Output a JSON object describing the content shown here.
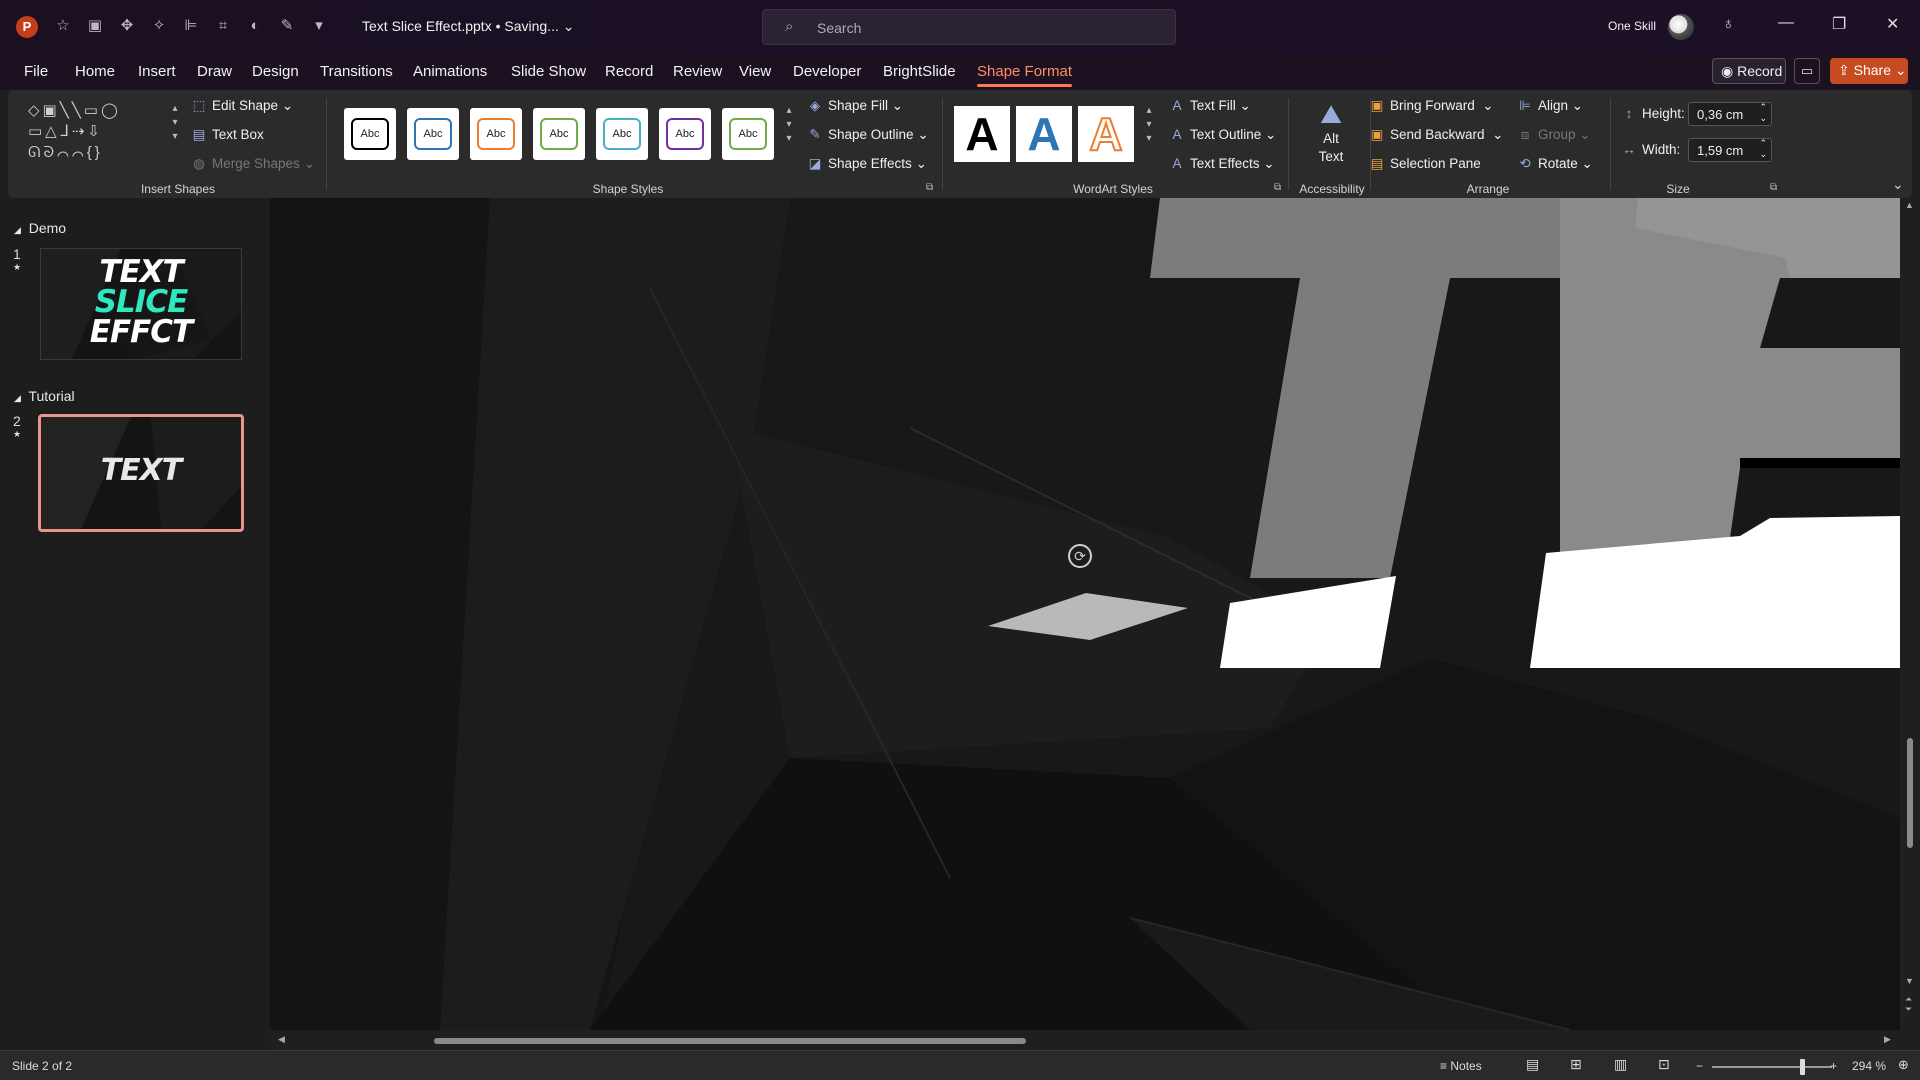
{
  "titlebar": {
    "app_logo": "P",
    "file_title": "Text Slice Effect.pptx • Saving...",
    "search_placeholder": "Search",
    "user_name": "One Skill",
    "qat_icons": [
      "autosave-icon",
      "image-icon",
      "move-icon",
      "shape-icon",
      "align-icon",
      "crop-icon",
      "fill-icon",
      "pen-icon",
      "customize-icon"
    ]
  },
  "tabs": [
    "File",
    "Home",
    "Insert",
    "Draw",
    "Design",
    "Transitions",
    "Animations",
    "Slide Show",
    "Record",
    "Review",
    "View",
    "Developer",
    "BrightSlide",
    "Shape Format"
  ],
  "active_tab": "Shape Format",
  "top_buttons": {
    "record": "Record",
    "share": "Share"
  },
  "ribbon": {
    "insert_shapes": {
      "label": "Insert Shapes",
      "edit_shape": "Edit Shape",
      "text_box": "Text Box",
      "merge_shapes": "Merge Shapes"
    },
    "shape_styles": {
      "label": "Shape Styles",
      "thumb_text": "Abc",
      "thumb_colors": [
        "#000000",
        "#2e75b6",
        "#ed7d31",
        "#70ad47",
        "#4bacc6",
        "#7030a0",
        "#70ad47"
      ],
      "shape_fill": "Shape Fill",
      "shape_outline": "Shape Outline",
      "shape_effects": "Shape Effects"
    },
    "wordart": {
      "label": "WordArt Styles",
      "letter": "A",
      "text_fill": "Text Fill",
      "text_outline": "Text Outline",
      "text_effects": "Text Effects"
    },
    "accessibility": {
      "label": "Accessibility",
      "alt_text_1": "Alt",
      "alt_text_2": "Text"
    },
    "arrange": {
      "label": "Arrange",
      "bring_forward": "Bring Forward",
      "send_backward": "Send Backward",
      "selection_pane": "Selection Pane",
      "align": "Align",
      "group": "Group",
      "rotate": "Rotate"
    },
    "size": {
      "label": "Size",
      "height_label": "Height:",
      "height_value": "0,36 cm",
      "width_label": "Width:",
      "width_value": "1,59 cm"
    }
  },
  "thumbnails": {
    "sections": [
      "Demo",
      "Tutorial"
    ],
    "slides": [
      {
        "number": "1",
        "lines": [
          "TEXT",
          "SLICE",
          "EFFCT"
        ]
      },
      {
        "number": "2",
        "lines": [
          "TEXT"
        ]
      }
    ]
  },
  "status": {
    "slide_info": "Slide 2 of 2",
    "notes": "Notes",
    "zoom": "294 %"
  },
  "colors": {
    "accent": "#ff7a50",
    "slice_teal": "#2ee8c0",
    "selected_border": "#e8968d"
  }
}
